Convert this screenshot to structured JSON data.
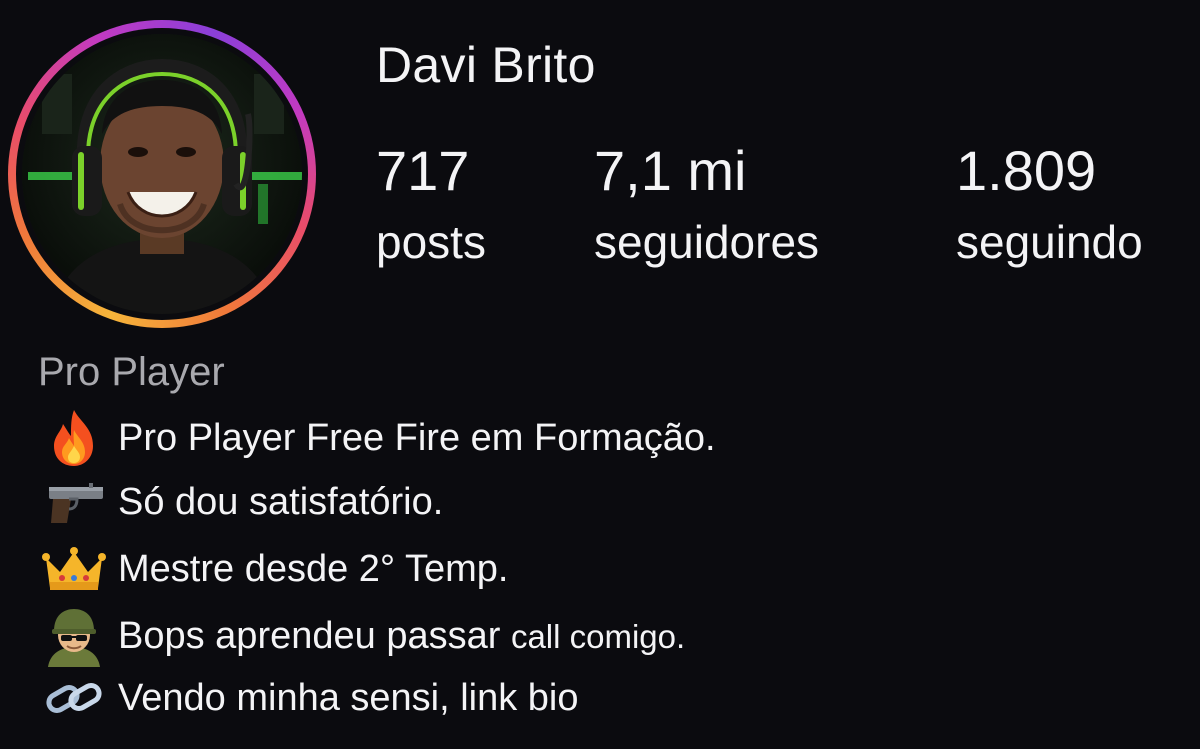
{
  "profile": {
    "username": "Davi Brito",
    "avatar_icon": "profile-photo",
    "story_ring_colors": [
      "#f6b53a",
      "#f0793a",
      "#e94c6a",
      "#c23ac2",
      "#8a3fd9"
    ]
  },
  "stats": {
    "posts": {
      "value": "717",
      "label": "posts"
    },
    "followers": {
      "value": "7,1 mi",
      "label": "seguidores"
    },
    "following": {
      "value": "1.809",
      "label": "seguindo"
    }
  },
  "category": "Pro Player",
  "bio": [
    {
      "icon": "fire-icon",
      "text": "Pro Player Free Fire em Formação."
    },
    {
      "icon": "pistol-icon",
      "text": "Só dou satisfatório."
    },
    {
      "icon": "crown-icon",
      "text": "Mestre desde 2° Temp."
    },
    {
      "icon": "soldier-icon",
      "text": "Bops aprendeu passar",
      "text_small": "call comigo."
    },
    {
      "icon": "link-icon",
      "text": "Vendo minha sensi, link bio"
    }
  ]
}
